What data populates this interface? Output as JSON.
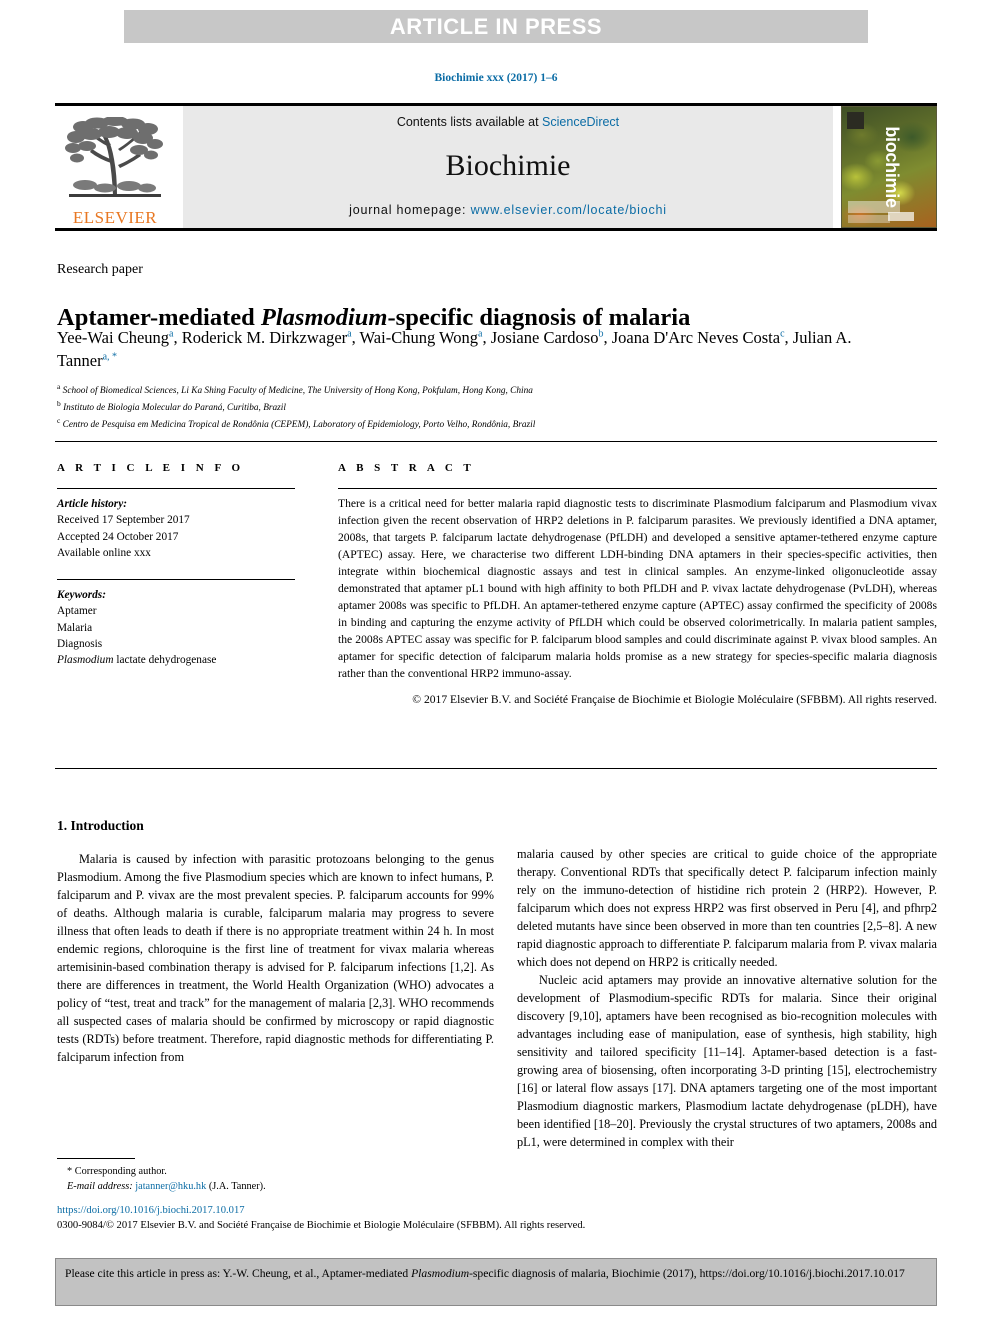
{
  "banner": {
    "text": "ARTICLE IN PRESS"
  },
  "running_head": {
    "text": "Biochimie xxx (2017) 1–6"
  },
  "masthead": {
    "contents_prefix": "Contents lists available at ",
    "contents_link": "ScienceDirect",
    "journal_name": "Biochimie",
    "homepage_prefix": "journal homepage: ",
    "homepage_link": "www.elsevier.com/locate/biochi",
    "publisher_word": "ELSEVIER",
    "cover_word": "biochimie"
  },
  "article": {
    "type_label": "Research paper",
    "title_part1": "Aptamer-mediated ",
    "title_italic": "Plasmodium",
    "title_part2": "-specific diagnosis of malaria",
    "authors": [
      {
        "name": "Yee-Wai Cheung",
        "marks": "a",
        "sep": ", "
      },
      {
        "name": "Roderick M. Dirkzwager",
        "marks": "a",
        "sep": ", "
      },
      {
        "name": "Wai-Chung Wong",
        "marks": "a",
        "sep": ", "
      },
      {
        "name": "Josiane Cardoso",
        "marks": "b",
        "sep": ", "
      },
      {
        "name": "Joana D'Arc Neves Costa",
        "marks": "c",
        "sep": ", "
      },
      {
        "name": "Julian A. Tanner",
        "marks": "a, *",
        "sep": ""
      }
    ],
    "affiliations": [
      {
        "mark": "a",
        "text": "School of Biomedical Sciences, Li Ka Shing Faculty of Medicine, The University of Hong Kong, Pokfulam, Hong Kong, China"
      },
      {
        "mark": "b",
        "text": "Instituto de Biologia Molecular do Paraná, Curitiba, Brazil"
      },
      {
        "mark": "c",
        "text": "Centro de Pesquisa em Medicina Tropical de Rondônia (CEPEM), Laboratory of Epidemiology, Porto Velho, Rondônia, Brazil"
      }
    ]
  },
  "article_info": {
    "heading": "A R T I C L E   I N F O",
    "history_label": "Article history:",
    "history": [
      "Received 17 September 2017",
      "Accepted 24 October 2017",
      "Available online xxx"
    ],
    "keywords_label": "Keywords:",
    "keywords": [
      "Aptamer",
      "Malaria",
      "Diagnosis",
      "Plasmodium lactate dehydrogenase"
    ],
    "keyword_italic_prefix": "Plasmodium",
    "keyword_italic_rest": " lactate dehydrogenase"
  },
  "abstract": {
    "heading": "A B S T R A C T",
    "text": "There is a critical need for better malaria rapid diagnostic tests to discriminate Plasmodium falciparum and Plasmodium vivax infection given the recent observation of HRP2 deletions in P. falciparum parasites. We previously identified a DNA aptamer, 2008s, that targets P. falciparum lactate dehydrogenase (PfLDH) and developed a sensitive aptamer-tethered enzyme capture (APTEC) assay. Here, we characterise two different LDH-binding DNA aptamers in their species-specific activities, then integrate within biochemical diagnostic assays and test in clinical samples. An enzyme-linked oligonucleotide assay demonstrated that aptamer pL1 bound with high affinity to both PfLDH and P. vivax lactate dehydrogenase (PvLDH), whereas aptamer 2008s was specific to PfLDH. An aptamer-tethered enzyme capture (APTEC) assay confirmed the specificity of 2008s in binding and capturing the enzyme activity of PfLDH which could be observed colorimetrically. In malaria patient samples, the 2008s APTEC assay was specific for P. falciparum blood samples and could discriminate against P. vivax blood samples. An aptamer for specific detection of falciparum malaria holds promise as a new strategy for species-specific malaria diagnosis rather than the conventional HRP2 immuno-assay.",
    "copyright": "© 2017 Elsevier B.V. and Société Française de Biochimie et Biologie Moléculaire (SFBBM). All rights reserved."
  },
  "body": {
    "section_heading": "1.  Introduction",
    "left_paragraphs": [
      "Malaria is caused by infection with parasitic protozoans belonging to the genus Plasmodium. Among the five Plasmodium species which are known to infect humans, P. falciparum and P. vivax are the most prevalent species. P. falciparum accounts for 99% of deaths. Although malaria is curable, falciparum malaria may progress to severe illness that often leads to death if there is no appropriate treatment within 24 h. In most endemic regions, chloroquine is the first line of treatment for vivax malaria whereas artemisinin-based combination therapy is advised for P. falciparum infections [1,2]. As there are differences in treatment, the World Health Organization (WHO) advocates a policy of “test, treat and track” for the management of malaria [2,3]. WHO recommends all suspected cases of malaria should be confirmed by microscopy or rapid diagnostic tests (RDTs) before treatment. Therefore, rapid diagnostic methods for differentiating P. falciparum infection from"
    ],
    "right_paragraphs": [
      "malaria caused by other species are critical to guide choice of the appropriate therapy. Conventional RDTs that specifically detect P. falciparum infection mainly rely on the immuno-detection of histidine rich protein 2 (HRP2). However, P. falciparum which does not express HRP2 was first observed in Peru [4], and pfhrp2 deleted mutants have since been observed in more than ten countries [2,5–8]. A new rapid diagnostic approach to differentiate P. falciparum malaria from P. vivax malaria which does not depend on HRP2 is critically needed.",
      "Nucleic acid aptamers may provide an innovative alternative solution for the development of Plasmodium-specific RDTs for malaria. Since their original discovery [9,10], aptamers have been recognised as bio-recognition molecules with advantages including ease of manipulation, ease of synthesis, high stability, high sensitivity and tailored specificity [11–14]. Aptamer-based detection is a fast-growing area of biosensing, often incorporating 3-D printing [15], electrochemistry [16] or lateral flow assays [17]. DNA aptamers targeting one of the most important Plasmodium diagnostic markers, Plasmodium lactate dehydrogenase (pLDH), have been identified [18–20]. Previously the crystal structures of two aptamers, 2008s and pL1, were determined in complex with their"
    ]
  },
  "footnote": {
    "corresponding": "* Corresponding author.",
    "email_label": "E-mail address:",
    "email": "jatanner@hku.hk",
    "email_owner": "(J.A. Tanner)."
  },
  "footer": {
    "doi": "https://doi.org/10.1016/j.biochi.2017.10.017",
    "issn": "0300-9084/© 2017 Elsevier B.V. and Société Française de Biochimie et Biologie Moléculaire (SFBBM). All rights reserved."
  },
  "cite_box": {
    "text_part1": "Please cite this article in press as: Y.-W. Cheung, et al., Aptamer-mediated ",
    "italic": "Plasmodium",
    "text_part2": "-specific diagnosis of malaria, Biochimie (2017), https://doi.org/10.1016/j.biochi.2017.10.017"
  },
  "colors": {
    "link": "#0b6ca5",
    "banner_bg": "#c7c7c7",
    "masthead_bg": "#e9e9e9",
    "elsevier_orange": "#e87722",
    "cite_bg": "#c2c2c2"
  }
}
